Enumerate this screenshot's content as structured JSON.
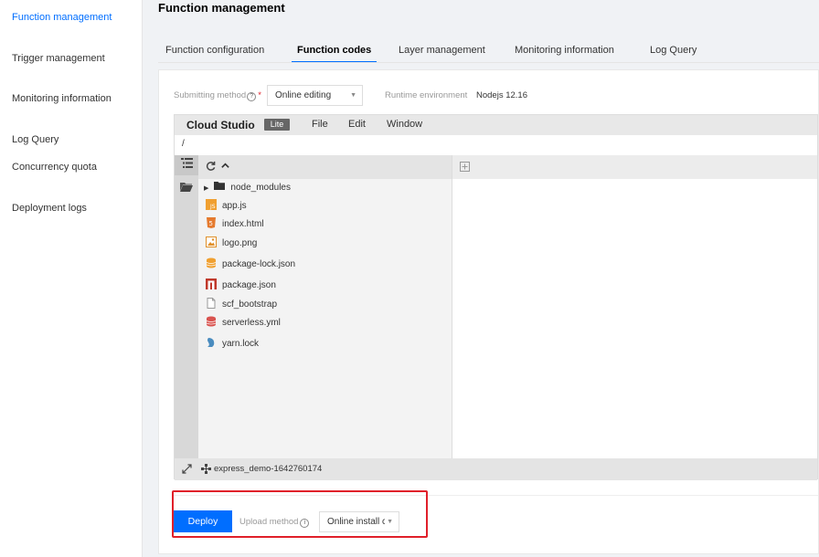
{
  "sidebar": {
    "items": [
      {
        "label": "Function management",
        "active": true
      },
      {
        "label": "Trigger management",
        "active": false
      },
      {
        "label": "Monitoring information",
        "active": false
      },
      {
        "label": "Log Query",
        "active": false
      },
      {
        "label": "Concurrency quota",
        "active": false
      },
      {
        "label": "Deployment logs",
        "active": false
      }
    ]
  },
  "header": {
    "title": "Function management"
  },
  "tabs": [
    {
      "label": "Function configuration"
    },
    {
      "label": "Function codes",
      "active": true
    },
    {
      "label": "Layer management"
    },
    {
      "label": "Monitoring information"
    },
    {
      "label": "Log Query"
    }
  ],
  "form": {
    "submit_method_label": "Submitting method",
    "submit_method_value": "Online editing",
    "runtime_label": "Runtime environment",
    "runtime_value": "Nodejs 12.16"
  },
  "ide": {
    "brand": "Cloud Studio",
    "badge": "Lite",
    "menus": [
      "File",
      "Edit",
      "Window"
    ],
    "path": "/",
    "files": [
      {
        "name": "node_modules",
        "icon": "folder-icon"
      },
      {
        "name": "app.js",
        "icon": "javascript-file-icon"
      },
      {
        "name": "index.html",
        "icon": "html-file-icon"
      },
      {
        "name": "logo.png",
        "icon": "image-file-icon"
      },
      {
        "name": "package-lock.json",
        "icon": "database-file-icon"
      },
      {
        "name": "package.json",
        "icon": "npm-file-icon"
      },
      {
        "name": "scf_bootstrap",
        "icon": "blank-file-icon"
      },
      {
        "name": "serverless.yml",
        "icon": "yaml-file-icon"
      },
      {
        "name": "yarn.lock",
        "icon": "yarn-file-icon"
      }
    ],
    "project_name": "express_demo-1642760174"
  },
  "footer": {
    "deploy_label": "Deploy",
    "upload_method_label": "Upload method",
    "upload_method_value": "Online install c"
  },
  "colors": {
    "accent": "#006eff",
    "highlight": "#e0202a"
  }
}
